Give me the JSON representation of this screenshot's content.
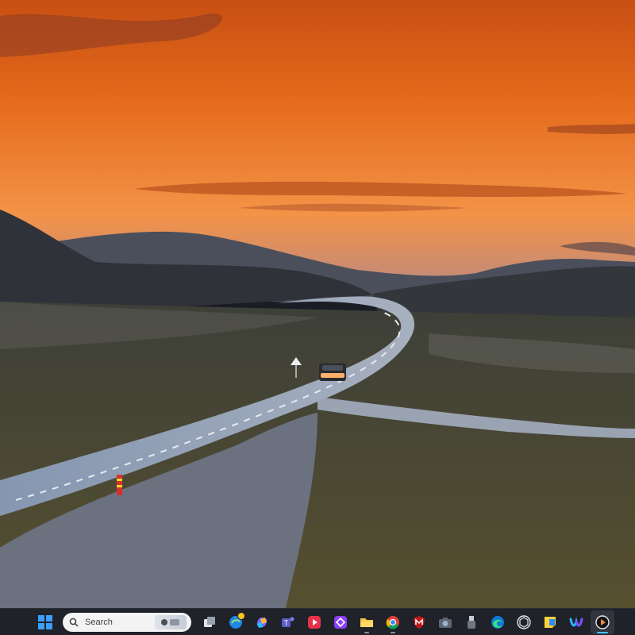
{
  "screen": {
    "kind": "desktop-wallpaper",
    "wallpaper": "sunset-winding-road"
  },
  "colors": {
    "sky_top": "#d45a14",
    "sky_horizon": "#f08a3c",
    "hills": "#33383f",
    "road": "#8a95a8",
    "grass": "#4d4a36",
    "taskbar": "#1f2229",
    "accent": "#4cc2ff"
  },
  "taskbar": {
    "search": {
      "label": "Search",
      "icon": "search-icon"
    },
    "apps": [
      {
        "name": "task-view",
        "icon": "task-view-icon"
      },
      {
        "name": "widgets",
        "icon": "widgets-icon"
      },
      {
        "name": "copilot",
        "icon": "copilot-icon"
      },
      {
        "name": "teams",
        "icon": "teams-icon"
      },
      {
        "name": "media-player",
        "icon": "play-icon"
      },
      {
        "name": "clipchamp",
        "icon": "diamond-app-icon"
      },
      {
        "name": "file-explorer",
        "icon": "folder-icon"
      },
      {
        "name": "chrome",
        "icon": "chrome-icon"
      },
      {
        "name": "mcafee",
        "icon": "shield-icon"
      },
      {
        "name": "camera",
        "icon": "camera-icon"
      },
      {
        "name": "usb-tool",
        "icon": "usb-icon"
      },
      {
        "name": "edge",
        "icon": "edge-icon"
      },
      {
        "name": "openai",
        "icon": "openai-icon"
      },
      {
        "name": "sticky-notes",
        "icon": "sticky-note-icon"
      },
      {
        "name": "webex",
        "icon": "webex-icon"
      },
      {
        "name": "video-player",
        "icon": "video-player-icon"
      }
    ]
  }
}
